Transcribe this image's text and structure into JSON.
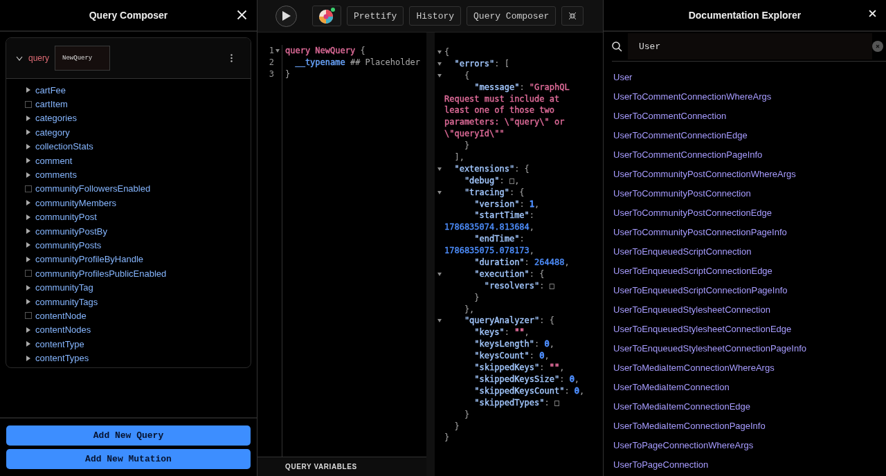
{
  "composer": {
    "title": "Query Composer",
    "operation": {
      "type": "query",
      "name": "NewQuery",
      "expanded": true
    },
    "fields": [
      {
        "name": "cartFee",
        "kind": "object"
      },
      {
        "name": "cartItem",
        "kind": "scalar",
        "checked": false
      },
      {
        "name": "categories",
        "kind": "object"
      },
      {
        "name": "category",
        "kind": "object"
      },
      {
        "name": "collectionStats",
        "kind": "object"
      },
      {
        "name": "comment",
        "kind": "object"
      },
      {
        "name": "comments",
        "kind": "object"
      },
      {
        "name": "communityFollowersEnabled",
        "kind": "scalar",
        "checked": false
      },
      {
        "name": "communityMembers",
        "kind": "object"
      },
      {
        "name": "communityPost",
        "kind": "object"
      },
      {
        "name": "communityPostBy",
        "kind": "object"
      },
      {
        "name": "communityPosts",
        "kind": "object"
      },
      {
        "name": "communityProfileByHandle",
        "kind": "object"
      },
      {
        "name": "communityProfilesPublicEnabled",
        "kind": "scalar",
        "checked": false
      },
      {
        "name": "communityTag",
        "kind": "object"
      },
      {
        "name": "communityTags",
        "kind": "object"
      },
      {
        "name": "contentNode",
        "kind": "scalar",
        "checked": false
      },
      {
        "name": "contentNodes",
        "kind": "object"
      },
      {
        "name": "contentType",
        "kind": "object"
      },
      {
        "name": "contentTypes",
        "kind": "object"
      }
    ],
    "buttons": [
      "Add New Query",
      "Add New Mutation"
    ]
  },
  "toolbar": {
    "buttons": [
      "Prettify",
      "History",
      "Query Composer"
    ]
  },
  "editor": {
    "lines": [
      {
        "number": "1",
        "fold": true,
        "tokens": [
          {
            "color": "#e06c9a",
            "text": "query NewQuery"
          },
          {
            "text": " {"
          }
        ]
      },
      {
        "number": "2",
        "fold": false,
        "tokens": [
          {
            "color": "#6aa6ff",
            "text": "  __typename"
          },
          {
            "text": " ## Placeholder"
          }
        ]
      },
      {
        "number": "3",
        "fold": false,
        "tokens": [
          {
            "text": "}"
          }
        ]
      }
    ],
    "variables_label": "QUERY VARIABLES"
  },
  "result": {
    "lines": [
      {
        "fold": true,
        "tokens": [
          {
            "text": "{"
          }
        ]
      },
      {
        "fold": true,
        "tokens": [
          {
            "color": "#a3c8ff",
            "text": "  \"errors\""
          },
          {
            "text": ": ["
          }
        ]
      },
      {
        "fold": true,
        "tokens": [
          {
            "text": "    {"
          }
        ]
      },
      {
        "fold": false,
        "tokens": [
          {
            "color": "#a3c8ff",
            "text": "      \"message\""
          },
          {
            "text": ": "
          },
          {
            "color": "#e06c9a",
            "text": "\"GraphQL"
          }
        ]
      },
      {
        "fold": false,
        "tokens": [
          {
            "color": "#e06c9a",
            "text": "Request must include at"
          }
        ]
      },
      {
        "fold": false,
        "tokens": [
          {
            "color": "#e06c9a",
            "text": "least one of those two"
          }
        ]
      },
      {
        "fold": false,
        "tokens": [
          {
            "color": "#e06c9a",
            "text": "parameters: \\\"query\\\" or"
          }
        ]
      },
      {
        "fold": false,
        "tokens": [
          {
            "color": "#e06c9a",
            "text": "\\\"queryId\\\"\""
          }
        ]
      },
      {
        "fold": false,
        "tokens": [
          {
            "text": "    }"
          }
        ]
      },
      {
        "fold": false,
        "tokens": [
          {
            "text": "  ],"
          }
        ]
      },
      {
        "fold": true,
        "tokens": [
          {
            "color": "#a3c8ff",
            "text": "  \"extensions\""
          },
          {
            "text": ": {"
          }
        ]
      },
      {
        "fold": false,
        "tokens": [
          {
            "color": "#a3c8ff",
            "text": "    \"debug\""
          },
          {
            "text": ": □,"
          }
        ]
      },
      {
        "fold": true,
        "tokens": [
          {
            "color": "#a3c8ff",
            "text": "    \"tracing\""
          },
          {
            "text": ": {"
          }
        ]
      },
      {
        "fold": false,
        "tokens": [
          {
            "color": "#a3c8ff",
            "text": "      \"version\""
          },
          {
            "text": ": "
          },
          {
            "color": "#4e8fff",
            "text": "1"
          },
          {
            "text": ","
          }
        ]
      },
      {
        "fold": false,
        "tokens": [
          {
            "color": "#a3c8ff",
            "text": "      \"startTime\""
          },
          {
            "text": ":"
          }
        ]
      },
      {
        "fold": false,
        "tokens": [
          {
            "color": "#4e8fff",
            "text": "1786835074.813684"
          },
          {
            "text": ","
          }
        ]
      },
      {
        "fold": false,
        "tokens": [
          {
            "color": "#a3c8ff",
            "text": "      \"endTime\""
          },
          {
            "text": ":"
          }
        ]
      },
      {
        "fold": false,
        "tokens": [
          {
            "color": "#4e8fff",
            "text": "1786835075.078173"
          },
          {
            "text": ","
          }
        ]
      },
      {
        "fold": false,
        "tokens": [
          {
            "color": "#a3c8ff",
            "text": "      \"duration\""
          },
          {
            "text": ": "
          },
          {
            "color": "#4e8fff",
            "text": "264488"
          },
          {
            "text": ","
          }
        ]
      },
      {
        "fold": true,
        "tokens": [
          {
            "color": "#a3c8ff",
            "text": "      \"execution\""
          },
          {
            "text": ": {"
          }
        ]
      },
      {
        "fold": false,
        "tokens": [
          {
            "color": "#a3c8ff",
            "text": "        \"resolvers\""
          },
          {
            "text": ": □"
          }
        ]
      },
      {
        "fold": false,
        "tokens": [
          {
            "text": "      }"
          }
        ]
      },
      {
        "fold": false,
        "tokens": [
          {
            "text": "    },"
          }
        ]
      },
      {
        "fold": true,
        "tokens": [
          {
            "color": "#a3c8ff",
            "text": "    \"queryAnalyzer\""
          },
          {
            "text": ": {"
          }
        ]
      },
      {
        "fold": false,
        "tokens": [
          {
            "color": "#a3c8ff",
            "text": "      \"keys\""
          },
          {
            "text": ": "
          },
          {
            "color": "#e06c9a",
            "text": "\"\""
          },
          {
            "text": ","
          }
        ]
      },
      {
        "fold": false,
        "tokens": [
          {
            "color": "#a3c8ff",
            "text": "      \"keysLength\""
          },
          {
            "text": ": "
          },
          {
            "color": "#4e8fff",
            "text": "0"
          },
          {
            "text": ","
          }
        ]
      },
      {
        "fold": false,
        "tokens": [
          {
            "color": "#a3c8ff",
            "text": "      \"keysCount\""
          },
          {
            "text": ": "
          },
          {
            "color": "#4e8fff",
            "text": "0"
          },
          {
            "text": ","
          }
        ]
      },
      {
        "fold": false,
        "tokens": [
          {
            "color": "#a3c8ff",
            "text": "      \"skippedKeys\""
          },
          {
            "text": ": "
          },
          {
            "color": "#e06c9a",
            "text": "\"\""
          },
          {
            "text": ","
          }
        ]
      },
      {
        "fold": false,
        "tokens": [
          {
            "color": "#a3c8ff",
            "text": "      \"skippedKeysSize\""
          },
          {
            "text": ": "
          },
          {
            "color": "#4e8fff",
            "text": "0"
          },
          {
            "text": ","
          }
        ]
      },
      {
        "fold": false,
        "tokens": [
          {
            "color": "#a3c8ff",
            "text": "      \"skippedKeysCount\""
          },
          {
            "text": ": "
          },
          {
            "color": "#4e8fff",
            "text": "0"
          },
          {
            "text": ","
          }
        ]
      },
      {
        "fold": false,
        "tokens": [
          {
            "color": "#a3c8ff",
            "text": "      \"skippedTypes\""
          },
          {
            "text": ": □"
          }
        ]
      },
      {
        "fold": false,
        "tokens": [
          {
            "text": "    }"
          }
        ]
      },
      {
        "fold": false,
        "tokens": [
          {
            "text": "  }"
          }
        ]
      },
      {
        "fold": false,
        "tokens": [
          {
            "text": "}"
          }
        ]
      }
    ]
  },
  "docs": {
    "title": "Documentation Explorer",
    "search": {
      "value": "User"
    },
    "results": [
      "User",
      "UserToCommentConnectionWhereArgs",
      "UserToCommentConnection",
      "UserToCommentConnectionEdge",
      "UserToCommentConnectionPageInfo",
      "UserToCommunityPostConnectionWhereArgs",
      "UserToCommunityPostConnection",
      "UserToCommunityPostConnectionEdge",
      "UserToCommunityPostConnectionPageInfo",
      "UserToEnqueuedScriptConnection",
      "UserToEnqueuedScriptConnectionEdge",
      "UserToEnqueuedScriptConnectionPageInfo",
      "UserToEnqueuedStylesheetConnection",
      "UserToEnqueuedStylesheetConnectionEdge",
      "UserToEnqueuedStylesheetConnectionPageInfo",
      "UserToMediaItemConnectionWhereArgs",
      "UserToMediaItemConnection",
      "UserToMediaItemConnectionEdge",
      "UserToMediaItemConnectionPageInfo",
      "UserToPageConnectionWhereArgs",
      "UserToPageConnection"
    ]
  }
}
